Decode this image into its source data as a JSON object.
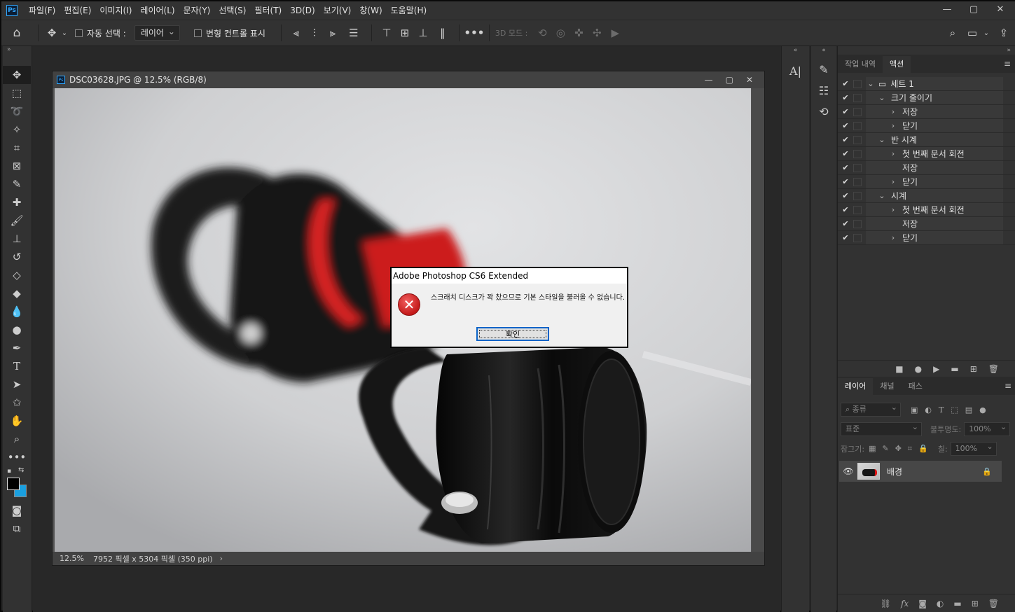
{
  "menubar": {
    "logo": "Ps",
    "items": [
      "파일(F)",
      "편집(E)",
      "이미지(I)",
      "레이어(L)",
      "문자(Y)",
      "선택(S)",
      "필터(T)",
      "3D(D)",
      "보기(V)",
      "창(W)",
      "도움말(H)"
    ]
  },
  "options": {
    "auto_select_label": "자동 선택 :",
    "auto_select_value": "레이어",
    "transform_label": "변형 컨트롤 표시",
    "mode3d_label": "3D 모드 :"
  },
  "document": {
    "title": "DSC03628.JPG @ 12.5% (RGB/8)",
    "zoom": "12.5%",
    "info": "7952 픽셀 x 5304 픽셀 (350 ppi)"
  },
  "dialog": {
    "title": "Adobe Photoshop CS6 Extended",
    "message": "스크래치 디스크가 꽉 찼으므로 기본 스타일을 불러올 수 없습니다.",
    "ok_label": "확인"
  },
  "actions_panel": {
    "tabs": [
      "작업 내역",
      "액션"
    ],
    "rows": [
      {
        "indent": 0,
        "twisty": "⌄",
        "folder": true,
        "label": "세트 1"
      },
      {
        "indent": 1,
        "twisty": "⌄",
        "label": "크기 줄이기"
      },
      {
        "indent": 2,
        "twisty": "›",
        "label": "저장"
      },
      {
        "indent": 2,
        "twisty": "›",
        "label": "닫기"
      },
      {
        "indent": 1,
        "twisty": "⌄",
        "label": "반 시계"
      },
      {
        "indent": 2,
        "twisty": "›",
        "label": "첫 번째 문서 회전"
      },
      {
        "indent": 2,
        "twisty": "",
        "label": "저장"
      },
      {
        "indent": 2,
        "twisty": "›",
        "label": "닫기"
      },
      {
        "indent": 1,
        "twisty": "⌄",
        "label": "시계"
      },
      {
        "indent": 2,
        "twisty": "›",
        "label": "첫 번째 문서 회전"
      },
      {
        "indent": 2,
        "twisty": "",
        "label": "저장"
      },
      {
        "indent": 2,
        "twisty": "›",
        "label": "닫기"
      }
    ]
  },
  "layers_panel": {
    "tabs": [
      "레이어",
      "채널",
      "패스"
    ],
    "filter_placeholder": "종류",
    "blend_mode": "표준",
    "opacity_label": "불투명도:",
    "opacity_value": "100%",
    "lock_label": "잠그기:",
    "fill_label": "칠:",
    "fill_value": "100%",
    "layer_name": "배경"
  }
}
